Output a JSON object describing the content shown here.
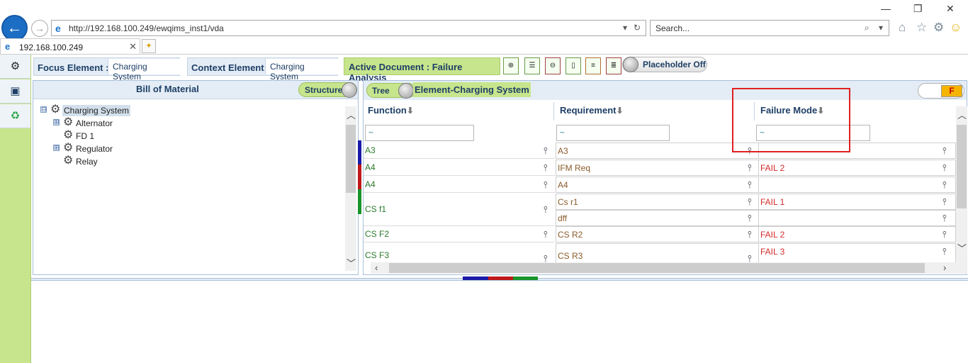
{
  "browser": {
    "url": "http://192.168.100.249/ewqims_inst1/vda",
    "search_placeholder": "Search...",
    "tab_title": "192.168.100.249",
    "win_min": "—",
    "win_restore": "❐",
    "win_close": "✕"
  },
  "toolbar": {
    "focus_label": "Focus Element :",
    "focus_value": "Charging System",
    "context_label": "Context Element",
    "context_value": "Charging System",
    "active_document": "Active Document : Failure Analysis",
    "placeholder_toggle": "Placeholder Off"
  },
  "bom": {
    "title": "Bill of Material",
    "structure_toggle": "Structure",
    "tree": [
      {
        "label": "Charging System",
        "expand": "⊟",
        "selected": true
      },
      {
        "label": "Alternator",
        "expand": "⊞"
      },
      {
        "label": "FD 1",
        "expand": ""
      },
      {
        "label": "Regulator",
        "expand": "⊞"
      },
      {
        "label": "Relay",
        "expand": ""
      }
    ]
  },
  "grid": {
    "tree_toggle": "Tree",
    "element_label": "Element-Charging System",
    "f_toggle": "F",
    "columns": {
      "function": "Function",
      "requirement": "Requirement",
      "failure_mode": "Failure Mode",
      "sort_arrow": "⬇"
    },
    "filters": {
      "function": "~",
      "requirement": "~",
      "failure_mode": "~"
    },
    "rows": [
      {
        "function": "A3",
        "requirement": "A3",
        "failure_mode": ""
      },
      {
        "function": "A4",
        "requirement": "IFM Req",
        "failure_mode": "FAIL 2"
      },
      {
        "function": "A4",
        "requirement": "A4",
        "failure_mode": ""
      },
      {
        "function": "CS f1",
        "requirement": "Cs r1",
        "failure_mode": "FAIL 1"
      },
      {
        "function": "",
        "requirement": "dff",
        "failure_mode": ""
      },
      {
        "function": "CS F2",
        "requirement": "CS R2",
        "failure_mode": "FAIL 2"
      },
      {
        "function": "CS F3",
        "requirement": "CS R3",
        "failure_mode": "FAIL 3"
      }
    ]
  },
  "colors": {
    "accent_green": "#c7e58c",
    "header_blue": "#e4edf6",
    "strip_blue": "#1a1aa8",
    "strip_red": "#c01818",
    "strip_green": "#18942a",
    "highlight_red": "#e02020"
  },
  "icons": {
    "hierarchy": "hierarchy-icon",
    "gear": "gear-icon"
  }
}
